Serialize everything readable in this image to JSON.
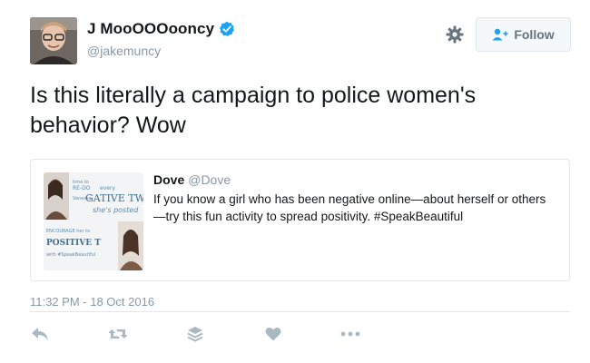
{
  "author": {
    "display_name": "J MooOOOooncy",
    "handle": "@jakemuncy",
    "verified": true
  },
  "header": {
    "follow_label": "Follow",
    "gear_icon": "gear-icon",
    "follow_icon": "add-user-icon"
  },
  "tweet": {
    "text": "Is this literally a campaign to police women's behavior? Wow",
    "timestamp": "11:32 PM - 18 Oct 2016"
  },
  "quote": {
    "name": "Dove",
    "handle": "@Dove",
    "text": "If you know a girl who has been negative online—about herself or others—try this fun activity to spread positivity. #SpeakBeautiful"
  },
  "actions": [
    "reply-icon",
    "retweet-icon",
    "stack-icon",
    "heart-icon",
    "more-icon"
  ],
  "colors": {
    "text": "#14171a",
    "muted": "#8899a6",
    "icon": "#aab8c2",
    "verified": "#1da1f2",
    "border": "#e1e8ed"
  }
}
